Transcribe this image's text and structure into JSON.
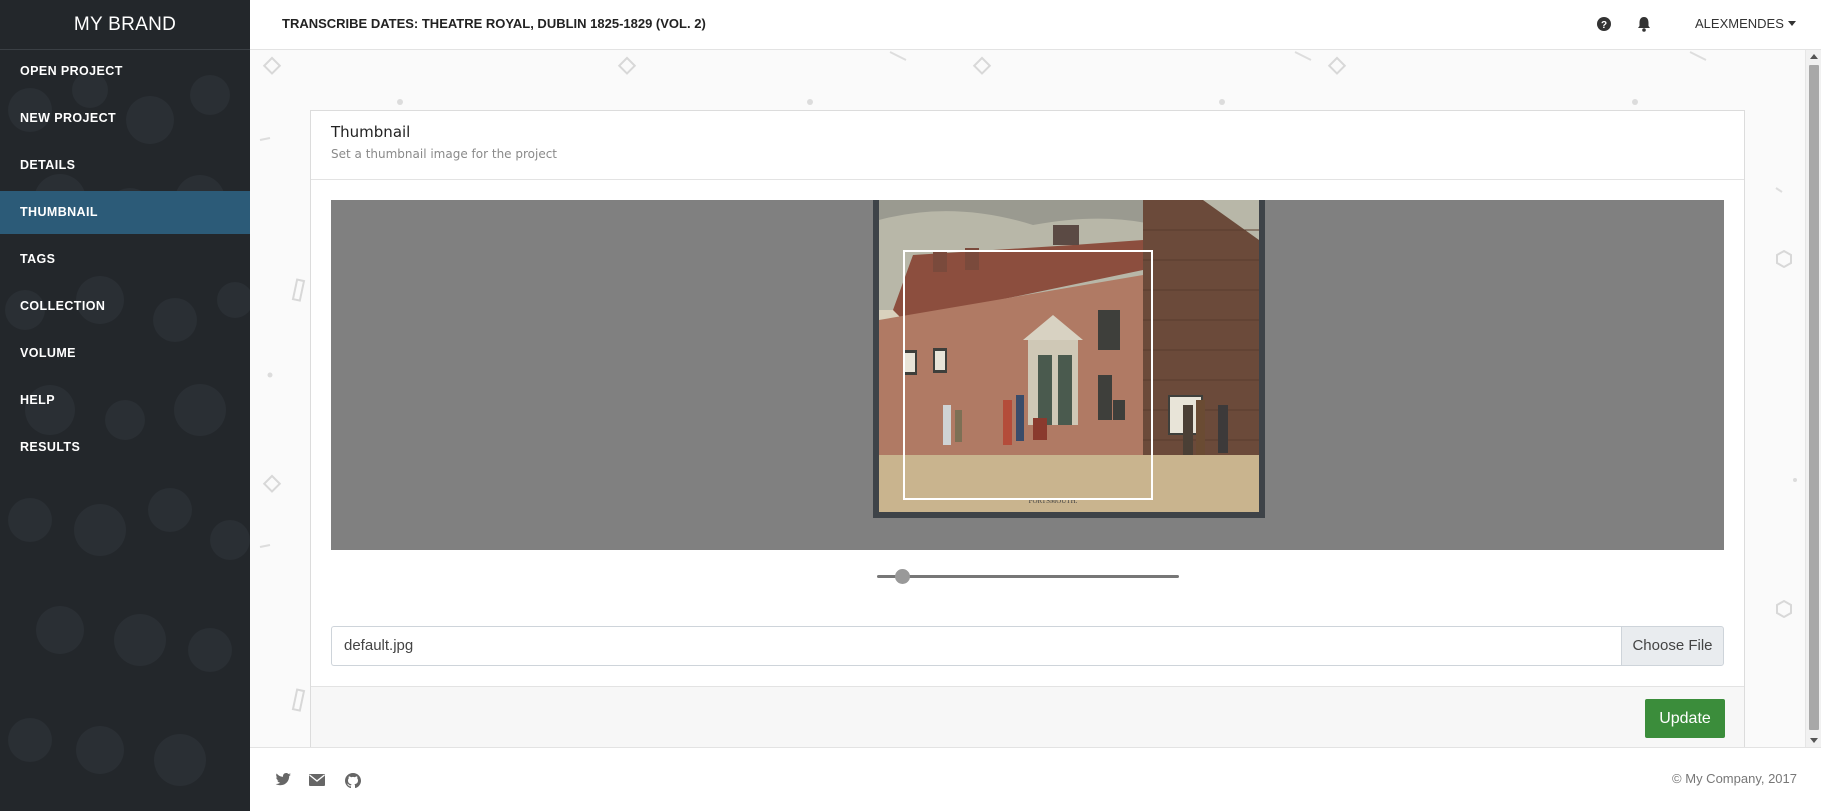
{
  "brand": "MY BRAND",
  "sidebar": {
    "items": [
      {
        "label": "OPEN PROJECT"
      },
      {
        "label": "NEW PROJECT"
      },
      {
        "label": "DETAILS"
      },
      {
        "label": "THUMBNAIL",
        "active": true
      },
      {
        "label": "TAGS"
      },
      {
        "label": "COLLECTION"
      },
      {
        "label": "VOLUME"
      },
      {
        "label": "HELP"
      },
      {
        "label": "RESULTS"
      }
    ]
  },
  "header": {
    "title": "TRANSCRIBE DATES: THEATRE ROYAL, DUBLIN 1825-1829 (VOL. 2)",
    "user": "ALEXMENDES",
    "icons": [
      "question-circle-icon",
      "bell-icon"
    ]
  },
  "card": {
    "title": "Thumbnail",
    "subtitle": "Set a thumbnail image for the project",
    "image_caption": "PORTSMOUTH.",
    "zoom_level": 0.05,
    "file_value": "default.jpg",
    "choose_label": "Choose File",
    "update_label": "Update"
  },
  "footer": {
    "icons": [
      "twitter-icon",
      "mail-icon",
      "github-icon"
    ],
    "copyright": "© My Company, 2017"
  },
  "colors": {
    "sidebar_bg": "#23272b",
    "sidebar_active": "#2c5b78",
    "update_button": "#3b8d3b",
    "cropper_bg": "#808080"
  }
}
